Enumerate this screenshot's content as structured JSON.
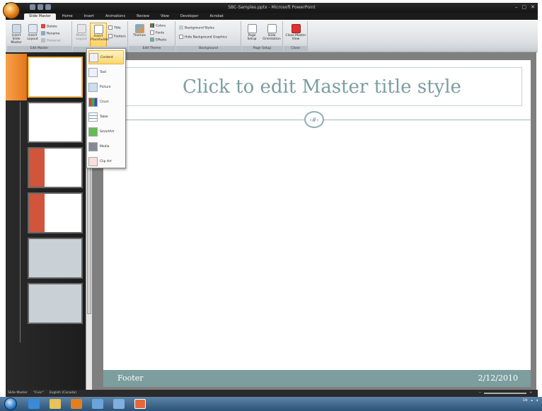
{
  "window": {
    "title": "SBC-Samples.pptx - Microsoft PowerPoint",
    "controls": [
      "–",
      "▢",
      "✕"
    ]
  },
  "tabs": [
    "Slide Master",
    "Home",
    "Insert",
    "Animations",
    "Review",
    "View",
    "Developer",
    "Acrobat"
  ],
  "ribbon": {
    "edit_master": {
      "label": "Edit Master",
      "insert_slide_master": "Insert Slide Master",
      "insert_layout": "Insert Layout",
      "delete": "Delete",
      "rename": "Rename",
      "preserve": "Preserve"
    },
    "master_layout": {
      "master_layout": "Master Layout",
      "insert_placeholder": "Insert Placeholder",
      "title": "Title",
      "footers": "Footers"
    },
    "edit_theme": {
      "label": "Edit Theme",
      "themes": "Themes",
      "colors": "Colors",
      "fonts": "Fonts",
      "effects": "Effects"
    },
    "background": {
      "label": "Background",
      "background_styles": "Background Styles",
      "hide_graphics": "Hide Background Graphics"
    },
    "page_setup": {
      "label": "Page Setup",
      "page_setup": "Page Setup",
      "slide_orientation": "Slide Orientation"
    },
    "close": {
      "label": "Close",
      "close_master_view": "Close Master View"
    }
  },
  "placeholder_menu": [
    {
      "label": "Content",
      "icon": "content-icon"
    },
    {
      "label": "Text",
      "icon": "text-icon"
    },
    {
      "label": "Picture",
      "icon": "picture-icon"
    },
    {
      "label": "Chart",
      "icon": "chart-icon"
    },
    {
      "label": "Table",
      "icon": "table-icon"
    },
    {
      "label": "SmartArt",
      "icon": "smartart-icon"
    },
    {
      "label": "Media",
      "icon": "media-icon"
    },
    {
      "label": "Clip Art",
      "icon": "clip-art-icon"
    }
  ],
  "slide": {
    "title": "Click to edit Master title style",
    "footer": "Footer",
    "date": "2/12/2010"
  },
  "status": {
    "view": "Slide Master",
    "theme": "\"Civic\"",
    "language": "English (Canada)"
  },
  "taskbar": {
    "lang": "EN"
  },
  "colors": {
    "accent": "#7c9e9f",
    "selection": "#f2b44a"
  }
}
